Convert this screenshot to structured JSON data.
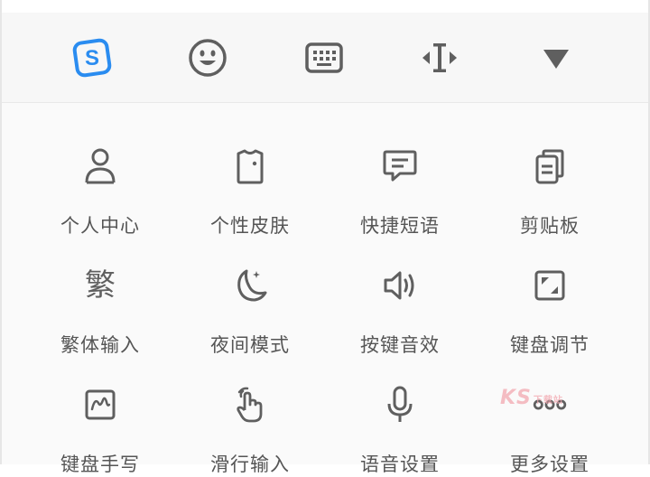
{
  "colors": {
    "accent": "#2a8cf0",
    "icon": "#5f5f5f",
    "label": "#555555",
    "watermark": "#f2a8b0"
  },
  "toolbar": {
    "items": [
      {
        "icon": "sogou-logo-icon"
      },
      {
        "icon": "emoji-icon"
      },
      {
        "icon": "keyboard-icon"
      },
      {
        "icon": "cursor-move-icon"
      },
      {
        "icon": "collapse-triangle-icon"
      }
    ],
    "logo_letter": "S"
  },
  "grid": {
    "items": [
      {
        "label": "个人中心",
        "icon": "user-icon"
      },
      {
        "label": "个性皮肤",
        "icon": "skin-shirt-icon"
      },
      {
        "label": "快捷短语",
        "icon": "chat-bubble-icon"
      },
      {
        "label": "剪贴板",
        "icon": "clipboard-icon"
      },
      {
        "label": "繁体输入",
        "icon": "traditional-char-icon",
        "glyph": "繁"
      },
      {
        "label": "夜间模式",
        "icon": "moon-icon"
      },
      {
        "label": "按键音效",
        "icon": "speaker-icon"
      },
      {
        "label": "键盘调节",
        "icon": "resize-square-icon"
      },
      {
        "label": "键盘手写",
        "icon": "handwriting-icon"
      },
      {
        "label": "滑行输入",
        "icon": "swipe-hand-icon"
      },
      {
        "label": "语音设置",
        "icon": "microphone-icon"
      },
      {
        "label": "更多设置",
        "icon": "more-dots-icon"
      }
    ]
  },
  "watermark": {
    "text": "KS",
    "sub": "下载站"
  }
}
